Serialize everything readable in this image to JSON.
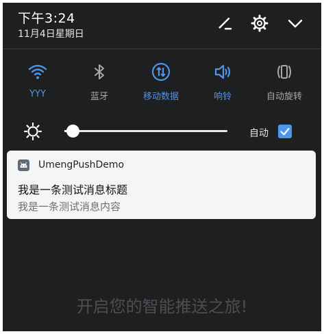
{
  "status": {
    "time": "下午3:24",
    "date": "11月4日星期日"
  },
  "header_icons": [
    "edit-icon",
    "settings-icon",
    "collapse-icon"
  ],
  "quick_settings": [
    {
      "label": "YYY",
      "icon": "wifi-icon",
      "active": true
    },
    {
      "label": "蓝牙",
      "icon": "bluetooth-icon",
      "active": false
    },
    {
      "label": "移动数据",
      "icon": "mobile-data-icon",
      "active": true
    },
    {
      "label": "响铃",
      "icon": "ring-icon",
      "active": true
    },
    {
      "label": "自动旋转",
      "icon": "auto-rotate-icon",
      "active": false
    }
  ],
  "brightness": {
    "level": 0.05,
    "auto_label": "自动",
    "auto_checked": true
  },
  "notification": {
    "app_name": "UmengPushDemo",
    "title": "我是一条测试消息标题",
    "body": "我是一条测试消息内容"
  },
  "background_text": "开启您的智能推送之旅!",
  "colors": {
    "accent": "#4e96e8",
    "shade": "#1e1f21",
    "card": "#f5f5f5"
  }
}
